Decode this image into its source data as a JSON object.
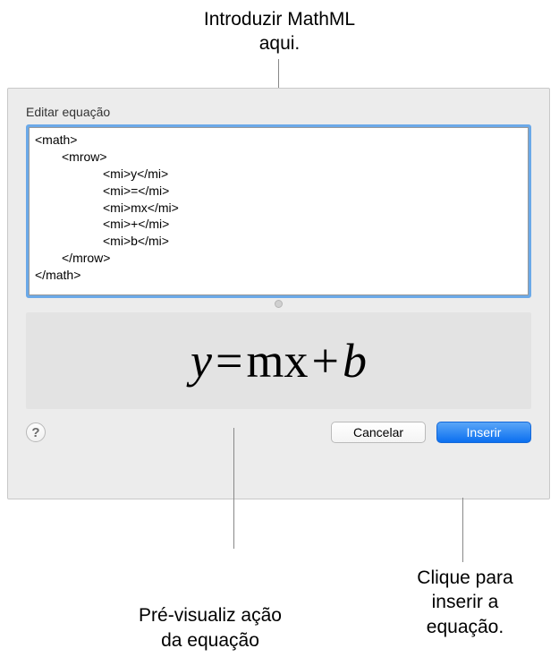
{
  "callouts": {
    "top": "Introduzir MathML aqui.",
    "bottomLeft": "Pré-visualiz ação da equação",
    "bottomRight": "Clique para inserir a equação."
  },
  "dialog": {
    "title": "Editar equação",
    "code": {
      "l0": "<math>",
      "l1": "<mrow>",
      "l2": "<mi>y</mi>",
      "l3": "<mi>=</mi>",
      "l4": "<mi>mx</mi>",
      "l5": "<mi>+</mi>",
      "l6": "<mi>b</mi>",
      "l7": "</mrow>",
      "l8": "</math>"
    },
    "preview": {
      "y": "y",
      "eq": "=",
      "mx": "mx",
      "plus": "+",
      "b": "b"
    },
    "help": "?",
    "cancel": "Cancelar",
    "insert": "Inserir"
  }
}
